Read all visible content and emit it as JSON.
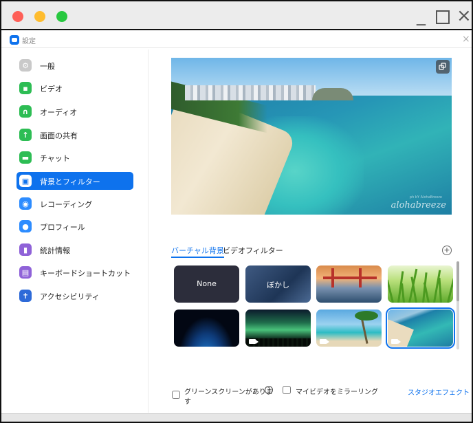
{
  "window": {
    "title": "設定",
    "controls": {
      "minimize": "_",
      "close": "×"
    }
  },
  "sidebar": {
    "items": [
      {
        "label": "一般",
        "icon": "gear-icon",
        "color": "#c9c9c9"
      },
      {
        "label": "ビデオ",
        "icon": "video-camera-icon",
        "color": "#2dbd54"
      },
      {
        "label": "オーディオ",
        "icon": "headphones-icon",
        "color": "#2dbd54"
      },
      {
        "label": "画面の共有",
        "icon": "screen-share-icon",
        "color": "#2dbd54"
      },
      {
        "label": "チャット",
        "icon": "chat-bubble-icon",
        "color": "#2dbd54"
      },
      {
        "label": "背景とフィルター",
        "icon": "background-person-icon",
        "color": "#0e72ed",
        "active": true
      },
      {
        "label": "レコーディング",
        "icon": "record-icon",
        "color": "#2d8cff"
      },
      {
        "label": "プロフィール",
        "icon": "profile-icon",
        "color": "#2d8cff"
      },
      {
        "label": "統計情報",
        "icon": "statistics-icon",
        "color": "#8f62d8"
      },
      {
        "label": "キーボードショートカット",
        "icon": "keyboard-icon",
        "color": "#8f62d8"
      },
      {
        "label": "アクセシビリティ",
        "icon": "accessibility-icon",
        "color": "#2d6ad8"
      }
    ]
  },
  "preview": {
    "watermark": "alohabreeze",
    "watermark_small": "ph bY AlohaBreeze"
  },
  "tabs": {
    "virtual_background": "バーチャル背景",
    "video_filter": "ビデオフィルター",
    "add": "+"
  },
  "backgrounds": {
    "none_label": "None",
    "blur_label": "ぼかし"
  },
  "footer": {
    "green_screen": "グリーンスクリーンがありま",
    "green_screen_wrap": "す",
    "help": "?",
    "mirror": "マイビデオをミラーリング",
    "studio": "スタジオエフェクト"
  }
}
